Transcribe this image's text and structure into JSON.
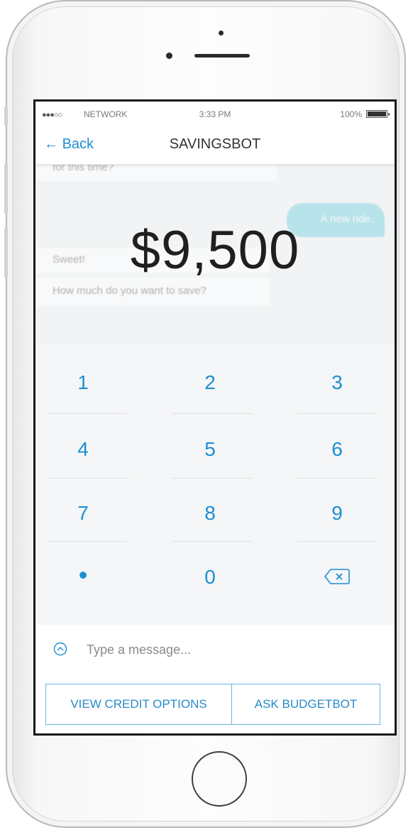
{
  "status_bar": {
    "signal": "●●●○○",
    "carrier": "NETWORK",
    "time": "3:33 PM",
    "battery": "100%"
  },
  "nav": {
    "back_label": "Back",
    "title": "SAVINGSBOT"
  },
  "chat": {
    "prev_bot_message": "for this time?",
    "user_message": "A new ride.",
    "bot_message_1": "Sweet!",
    "bot_message_2": "How much do you want to save?"
  },
  "amount_display": "$9,500",
  "keypad": {
    "keys": [
      "1",
      "2",
      "3",
      "4",
      "5",
      "6",
      "7",
      "8",
      "9",
      "•",
      "0"
    ],
    "backspace_icon": "backspace-icon"
  },
  "composer": {
    "placeholder": "Type a message...",
    "expand_icon": "chevron-up-circle-icon"
  },
  "actions": {
    "left_label": "VIEW CREDIT OPTIONS",
    "right_label": "ASK BUDGETBOT"
  },
  "colors": {
    "accent": "#1c8fd2",
    "bubble": "#7fd3e0",
    "keypad_bg": "#f5f6f7"
  }
}
